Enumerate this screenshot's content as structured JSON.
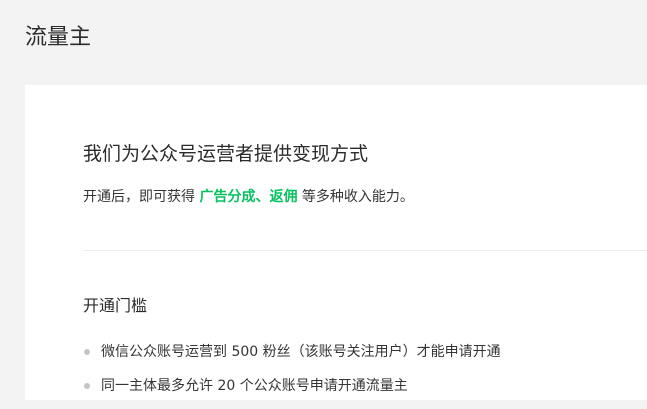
{
  "page": {
    "title": "流量主"
  },
  "intro": {
    "headline": "我们为公众号运营者提供变现方式",
    "desc_prefix": "开通后，即可获得 ",
    "desc_highlight": "广告分成、返佣",
    "desc_suffix": " 等多种收入能力。",
    "highlight_color": "#07c160"
  },
  "requirements": {
    "title": "开通门槛",
    "items": [
      {
        "text": "微信公众账号运营到 500 粉丝（该账号关注用户）才能申请开通"
      },
      {
        "text": "同一主体最多允许 20 个公众账号申请开通流量主"
      }
    ]
  }
}
